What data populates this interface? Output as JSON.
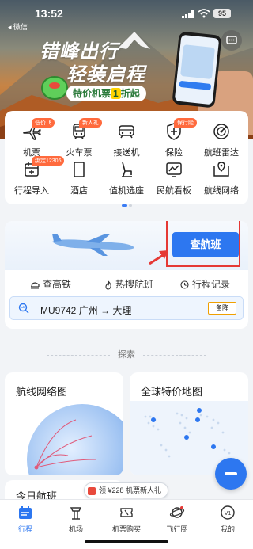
{
  "status_bar": {
    "time": "13:52",
    "battery": "95",
    "back_label": "◂ 微信"
  },
  "banner": {
    "slogan_line1": "错峰出行",
    "slogan_line2": "轻装启程",
    "promo_text": "特价机票",
    "promo_highlight": "1",
    "promo_suffix": "折起"
  },
  "grid": {
    "items": [
      {
        "label": "机票",
        "tag": "低价飞",
        "icon": "plane-icon"
      },
      {
        "label": "火车票",
        "tag": "新人礼",
        "icon": "train-icon"
      },
      {
        "label": "接送机",
        "tag": "",
        "icon": "car-icon"
      },
      {
        "label": "保险",
        "tag": "保行险",
        "icon": "shield-plus-icon"
      },
      {
        "label": "航班雷达",
        "tag": "",
        "icon": "radar-icon"
      },
      {
        "label": "行程导入",
        "tag": "绑定12306",
        "icon": "calendar-import-icon"
      },
      {
        "label": "酒店",
        "tag": "",
        "icon": "hotel-icon"
      },
      {
        "label": "值机选座",
        "tag": "",
        "icon": "seat-icon"
      },
      {
        "label": "民航看板",
        "tag": "",
        "icon": "dashboard-icon"
      },
      {
        "label": "航线网络",
        "tag": "",
        "icon": "route-map-icon"
      }
    ]
  },
  "flight_search": {
    "search_button": "查航班",
    "tabs": [
      "查高铁",
      "热搜航班",
      "行程记录"
    ],
    "route": {
      "flight_no": "MU9742",
      "from": "广州",
      "to": "大理",
      "arrow": "→",
      "status": "备降"
    }
  },
  "explore": {
    "title": "探索"
  },
  "cards": {
    "route_network": "航线网络图",
    "global_map": "全球特价地图",
    "today_flights": "今日航班"
  },
  "coupon": {
    "text": "领 ¥228 机票新人礼"
  },
  "bottom_nav": [
    {
      "label": "行程",
      "icon": "itinerary-icon",
      "active": true
    },
    {
      "label": "机场",
      "icon": "airport-tower-icon",
      "active": false
    },
    {
      "label": "机票购买",
      "icon": "ticket-icon",
      "active": false
    },
    {
      "label": "飞行圈",
      "icon": "planet-icon",
      "active": false
    },
    {
      "label": "我的",
      "icon": "profile-icon",
      "active": false
    }
  ],
  "colors": {
    "accent": "#2d77f0",
    "highlight_box": "#e53935"
  }
}
